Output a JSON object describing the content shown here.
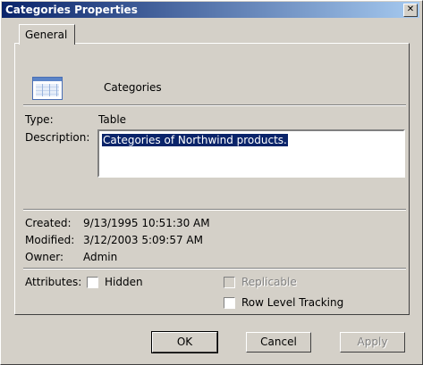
{
  "window": {
    "title": "Categories Properties"
  },
  "tabs": [
    {
      "label": "General"
    }
  ],
  "object": {
    "name": "Categories",
    "icon": "table-icon"
  },
  "fields": {
    "type_label": "Type:",
    "type_value": "Table",
    "description_label": "Description:",
    "description_value": "Categories of Northwind products."
  },
  "info": {
    "created_label": "Created:",
    "created_value": "9/13/1995 10:51:30 AM",
    "modified_label": "Modified:",
    "modified_value": "3/12/2003 5:09:57 AM",
    "owner_label": "Owner:",
    "owner_value": "Admin"
  },
  "attributes": {
    "label": "Attributes:",
    "hidden": {
      "label": "Hidden",
      "checked": false
    },
    "replicable": {
      "label": "Replicable",
      "checked": false,
      "enabled": false
    },
    "row_level_tracking": {
      "label": "Row Level Tracking",
      "checked": false
    }
  },
  "buttons": {
    "ok": "OK",
    "cancel": "Cancel",
    "apply": "Apply"
  },
  "colors": {
    "titlebar_start": "#0a246a",
    "titlebar_end": "#a6caf0",
    "face": "#d4d0c8",
    "selection": "#0a246a"
  }
}
